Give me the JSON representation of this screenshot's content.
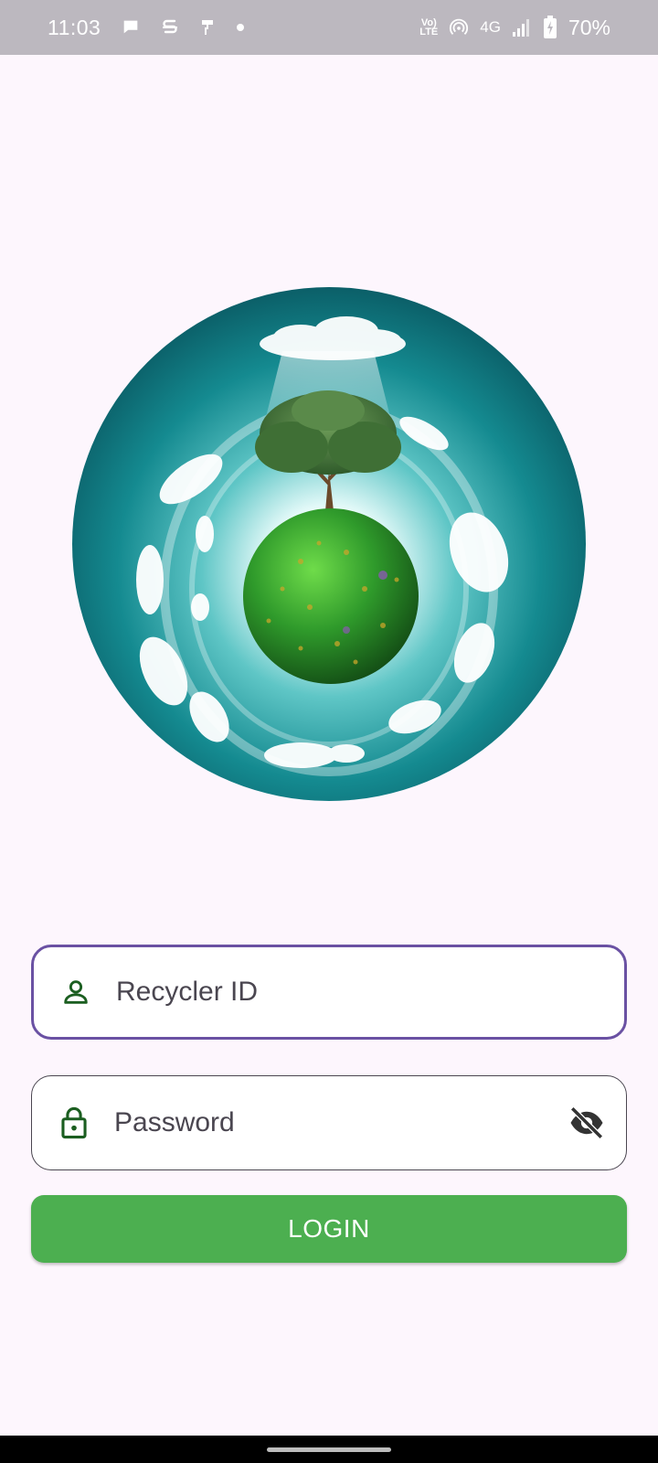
{
  "status_bar": {
    "time": "11:03",
    "network_label": "4G",
    "volte_label_top": "Vo)",
    "volte_label_bottom": "LTE",
    "battery_percent": "70%"
  },
  "login_form": {
    "recycler_id": {
      "placeholder": "Recycler ID",
      "value": "",
      "icon": "person-icon"
    },
    "password": {
      "placeholder": "Password",
      "value": "",
      "icon": "lock-icon",
      "toggle_icon": "eye-off-icon"
    },
    "login_button_label": "LOGIN"
  },
  "colors": {
    "background": "#fdf6fd",
    "status_bar": "#bcb8bf",
    "focused_border": "#6a51a3",
    "icon_green": "#1b5e20",
    "button_green": "#4caf50"
  }
}
